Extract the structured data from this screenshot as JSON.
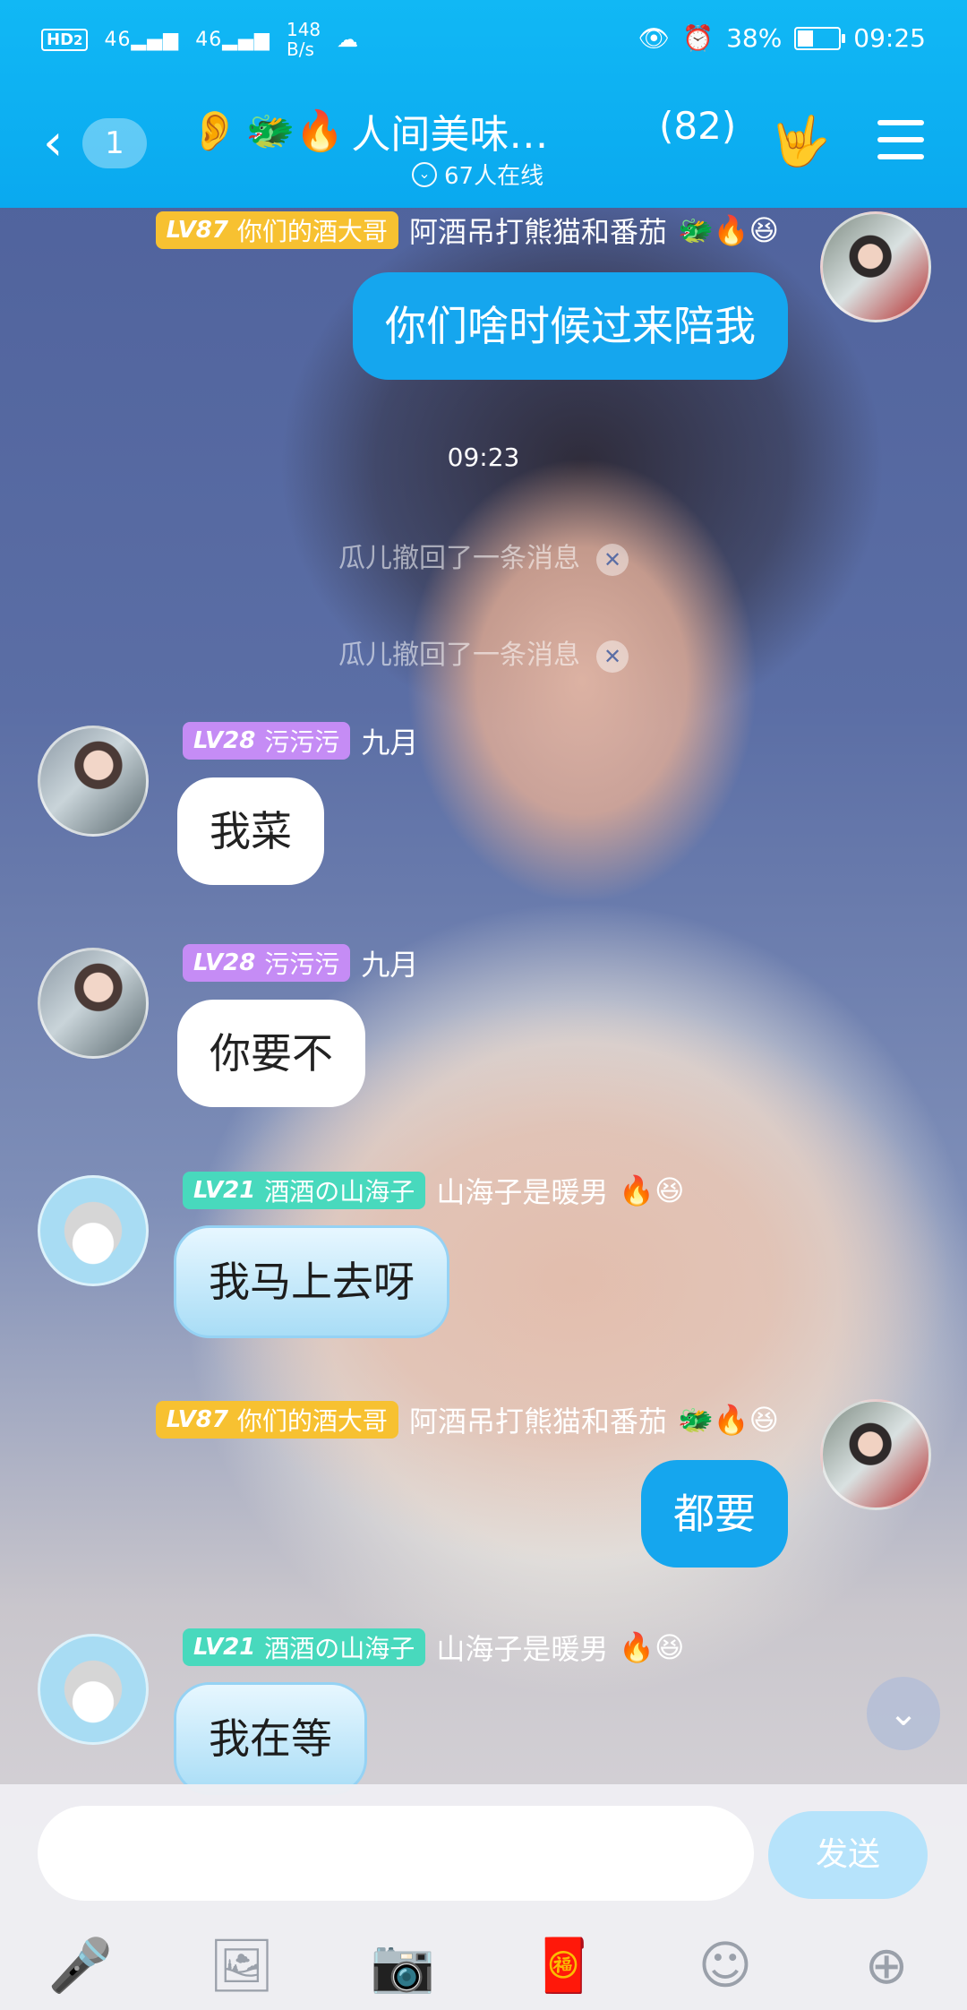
{
  "status_bar": {
    "hd": "HD",
    "hd_sub": "2",
    "net1": "46",
    "net2": "46",
    "speed": "148",
    "speed_unit": "B/s",
    "battery": "38%",
    "time": "09:25"
  },
  "header": {
    "back_badge": "1",
    "title": "人间美味…",
    "member_count": "(82)",
    "online": "67人在线",
    "emoji": "🐲🔥"
  },
  "messages": [
    {
      "side": "right",
      "level": "LV87",
      "tag": "你们的酒大哥",
      "name": "阿酒吊打熊猫和番茄",
      "emoji": "🐲🔥😆",
      "text": "你们啥时候过来陪我"
    },
    {
      "side": "left",
      "level": "LV28",
      "tag": "污污污",
      "name": "九月",
      "text": "我菜"
    },
    {
      "side": "left",
      "level": "LV28",
      "tag": "污污污",
      "name": "九月",
      "text": "你要不"
    },
    {
      "side": "left",
      "level": "LV21",
      "tag": "酒酒の山海子",
      "name": "山海子是暖男",
      "emoji": "🔥😆",
      "text": "我马上去呀"
    },
    {
      "side": "right",
      "level": "LV87",
      "tag": "你们的酒大哥",
      "name": "阿酒吊打熊猫和番茄",
      "emoji": "🐲🔥😆",
      "text": "都要"
    },
    {
      "side": "left",
      "level": "LV21",
      "tag": "酒酒の山海子",
      "name": "山海子是暖男",
      "emoji": "🔥😆",
      "text": "我在等"
    }
  ],
  "system": {
    "time": "09:23",
    "recall_1": "瓜儿撤回了一条消息",
    "recall_2": "瓜儿撤回了一条消息"
  },
  "input": {
    "value": "",
    "send_label": "发送"
  },
  "toolbar": [
    "microphone-icon",
    "image-icon",
    "camera-icon",
    "red-packet-icon",
    "emoji-icon",
    "plus-icon"
  ]
}
